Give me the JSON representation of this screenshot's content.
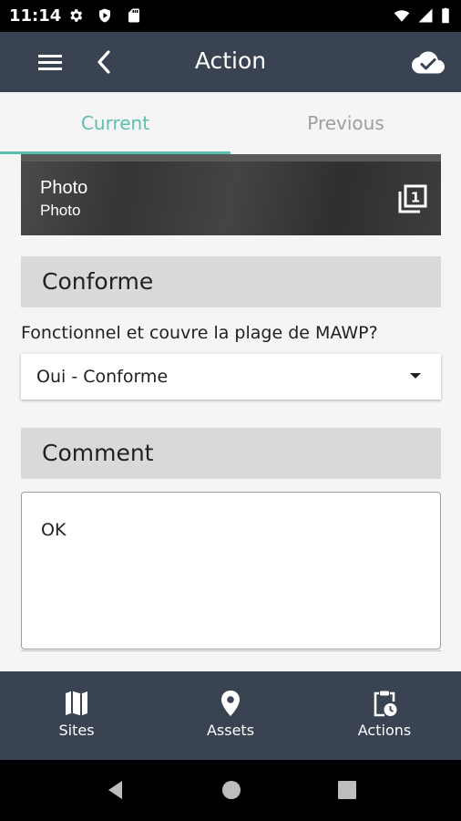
{
  "status_bar": {
    "time": "11:14"
  },
  "app_bar": {
    "title": "Action"
  },
  "tabs": [
    {
      "label": "Current",
      "active": true
    },
    {
      "label": "Previous",
      "active": false
    }
  ],
  "photo_card": {
    "title": "Photo",
    "subtitle": "Photo",
    "badge": "1"
  },
  "sections": {
    "conforme": {
      "header": "Conforme",
      "question": "Fonctionnel et couvre la plage de MAWP?",
      "selected_value": "Oui - Conforme"
    },
    "comment": {
      "header": "Comment",
      "value": "OK"
    }
  },
  "bottom_nav": [
    {
      "label": "Sites",
      "icon": "map-icon"
    },
    {
      "label": "Assets",
      "icon": "location-pin-icon"
    },
    {
      "label": "Actions",
      "icon": "clipboard-clock-icon"
    }
  ],
  "colors": {
    "app_bar": "#394352",
    "accent": "#5cbfae",
    "inactive_tab": "#9e9e9e",
    "section_header": "#d9d9d9"
  }
}
